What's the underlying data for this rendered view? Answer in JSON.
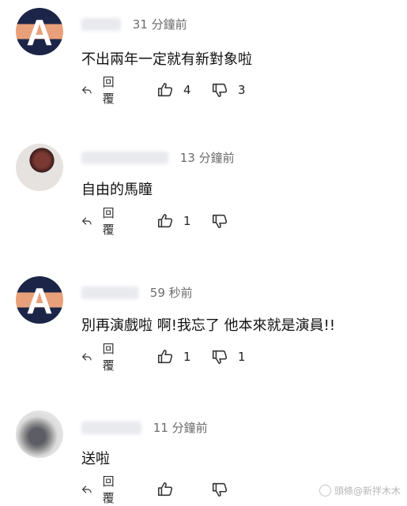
{
  "comments": [
    {
      "avatar_letter": "A",
      "time": "31 分鐘前",
      "text": "不出兩年一定就有新對象啦",
      "reply_label": "回覆",
      "like_count": "4",
      "dislike_count": "3"
    },
    {
      "avatar_letter": "",
      "time": "13 分鐘前",
      "text": "自由的馬瞳",
      "reply_label": "回覆",
      "like_count": "1",
      "dislike_count": ""
    },
    {
      "avatar_letter": "A",
      "time": "59 秒前",
      "text": "別再演戲啦 啊!我忘了 他本來就是演員!!",
      "reply_label": "回覆",
      "like_count": "1",
      "dislike_count": "1"
    },
    {
      "avatar_letter": "",
      "time": "11 分鐘前",
      "text": "送啦",
      "reply_label": "回覆",
      "like_count": "",
      "dislike_count": ""
    }
  ],
  "watermark": "頭條@新拌木木",
  "icons": {
    "reply": "reply-icon",
    "like": "thumbs-up-icon",
    "dislike": "thumbs-down-icon"
  }
}
